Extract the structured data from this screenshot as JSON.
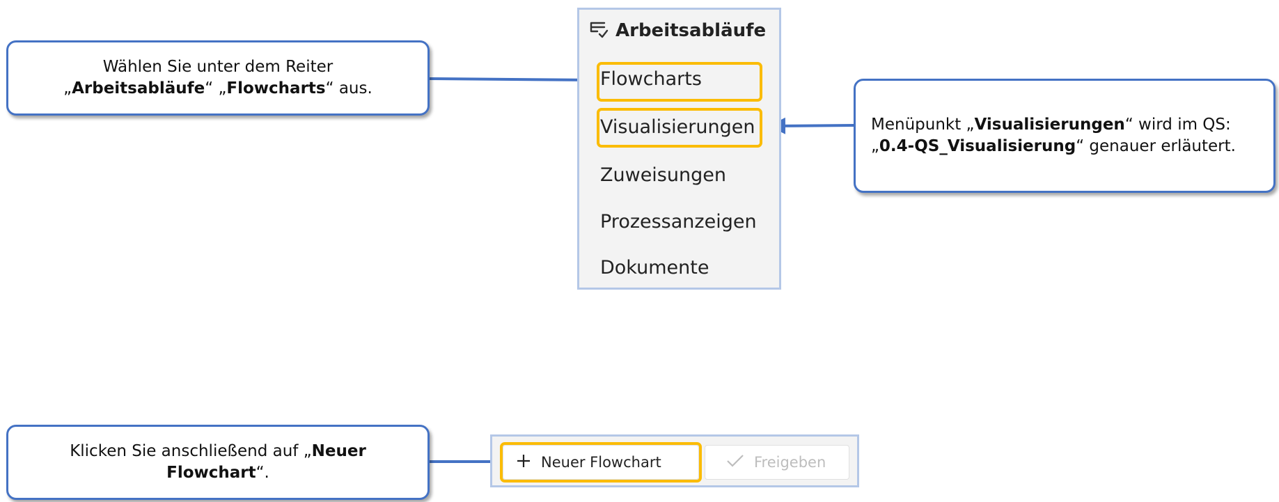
{
  "callouts": {
    "flowcharts": {
      "line1": "Wählen Sie unter dem Reiter",
      "q1": "„",
      "b1": "Arbeitsabläufe",
      "q2": "“ „",
      "b2": "Flowcharts",
      "q3": "“ aus."
    },
    "visualisierungen": {
      "pre": "Menüpunkt „",
      "b1": "Visualisierungen",
      "mid": "“ wird im QS:",
      "q1": "„",
      "b2": "0.4-QS_Visualisierung",
      "post": "“ genauer erläutert."
    },
    "new_flowchart": {
      "pre": "Klicken Sie anschließend auf „",
      "b1": "Neuer",
      "b2": "Flowchart",
      "post": "“."
    }
  },
  "menu": {
    "title": "Arbeitsabläufe",
    "icon": "list-check-icon",
    "items": [
      "Flowcharts",
      "Visualisierungen",
      "Zuweisungen",
      "Prozessanzeigen",
      "Dokumente"
    ]
  },
  "toolbar": {
    "new_label": "Neuer Flowchart",
    "release_label": "Freigeben"
  },
  "colors": {
    "callout_border": "#4472c4",
    "highlight": "#fbbc05",
    "frame": "#b4c7e7"
  }
}
